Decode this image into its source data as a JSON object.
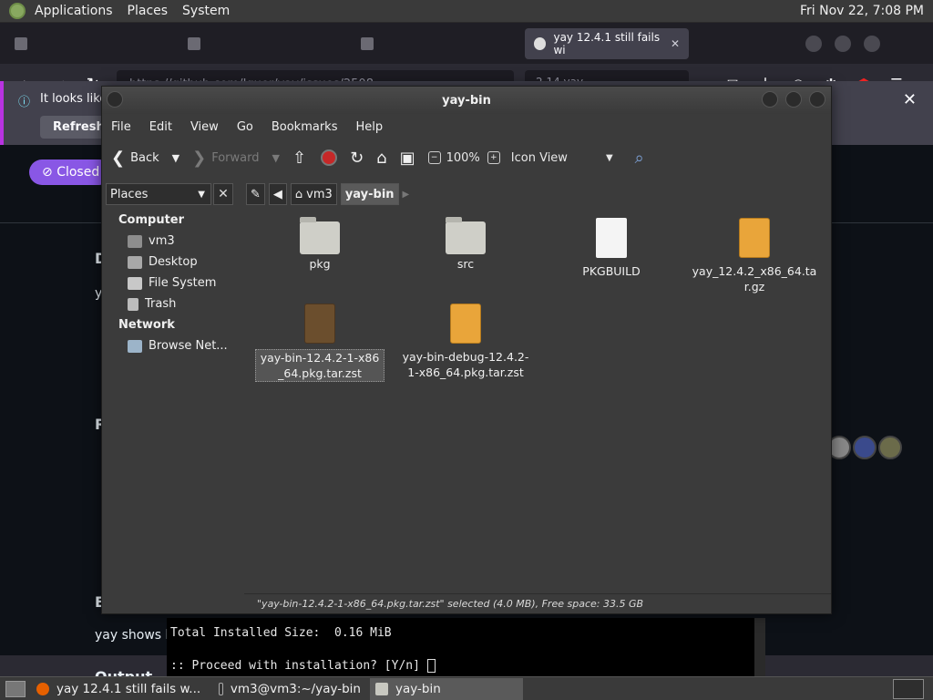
{
  "top_panel": {
    "menus": [
      "Applications",
      "Places",
      "System"
    ],
    "clock": "Fri Nov 22,  7:08 PM"
  },
  "browser": {
    "tabs": [
      {
        "label": ""
      },
      {
        "label": ""
      },
      {
        "label": ""
      },
      {
        "label": "yay 12.4.1 still fails wi",
        "active": true
      }
    ],
    "url": "https://github.com/Jguer/yay/issues/2508",
    "url_ext": "2.14 yay",
    "infobar_text": "It looks like",
    "infobar_button": "Refresh F",
    "closed_badge": "Closed"
  },
  "file_manager": {
    "title": "yay-bin",
    "menus": [
      "File",
      "Edit",
      "View",
      "Go",
      "Bookmarks",
      "Help"
    ],
    "toolbar": {
      "back": "Back",
      "forward": "Forward",
      "zoom": "100%",
      "view_mode": "Icon View"
    },
    "sidebar_select": "Places",
    "breadcrumbs": [
      "vm3",
      "yay-bin"
    ],
    "sidebar": {
      "computer_heading": "Computer",
      "computer_items": [
        "vm3",
        "Desktop",
        "File System",
        "Trash"
      ],
      "network_heading": "Network",
      "network_items": [
        "Browse Net..."
      ]
    },
    "files": [
      {
        "name": "pkg",
        "type": "folder"
      },
      {
        "name": "src",
        "type": "folder"
      },
      {
        "name": "PKGBUILD",
        "type": "document"
      },
      {
        "name": "yay_12.4.2_x86_64.tar.gz",
        "type": "archive"
      },
      {
        "name": "yay-bin-12.4.2-1-x86_64.pkg.tar.zst",
        "type": "archive",
        "selected": true
      },
      {
        "name": "yay-bin-debug-12.4.2-1-x86_64.pkg.tar.zst",
        "type": "archive"
      }
    ],
    "status": "\"yay-bin-12.4.2-1-x86_64.pkg.tar.zst\" selected (4.0 MB), Free space: 33.5 GB"
  },
  "terminal": {
    "lines": [
      "Total Installed Size:  0.16 MiB",
      "",
      ":: Proceed with installation? [Y/n] "
    ]
  },
  "page_fragments": {
    "left_letters": [
      "D",
      "y",
      "R",
      "E"
    ],
    "text_line": "yay shows h",
    "output_heading": "Output"
  },
  "taskbar": {
    "tasks": [
      "yay 12.4.1 still fails w...",
      "vm3@vm3:~/yay-bin",
      "yay-bin"
    ]
  },
  "colors": {
    "panel": "#3a3a3a",
    "window_bg": "#3b3b3b",
    "github_bg": "#0d1117",
    "closed_purple": "#8957e5"
  }
}
